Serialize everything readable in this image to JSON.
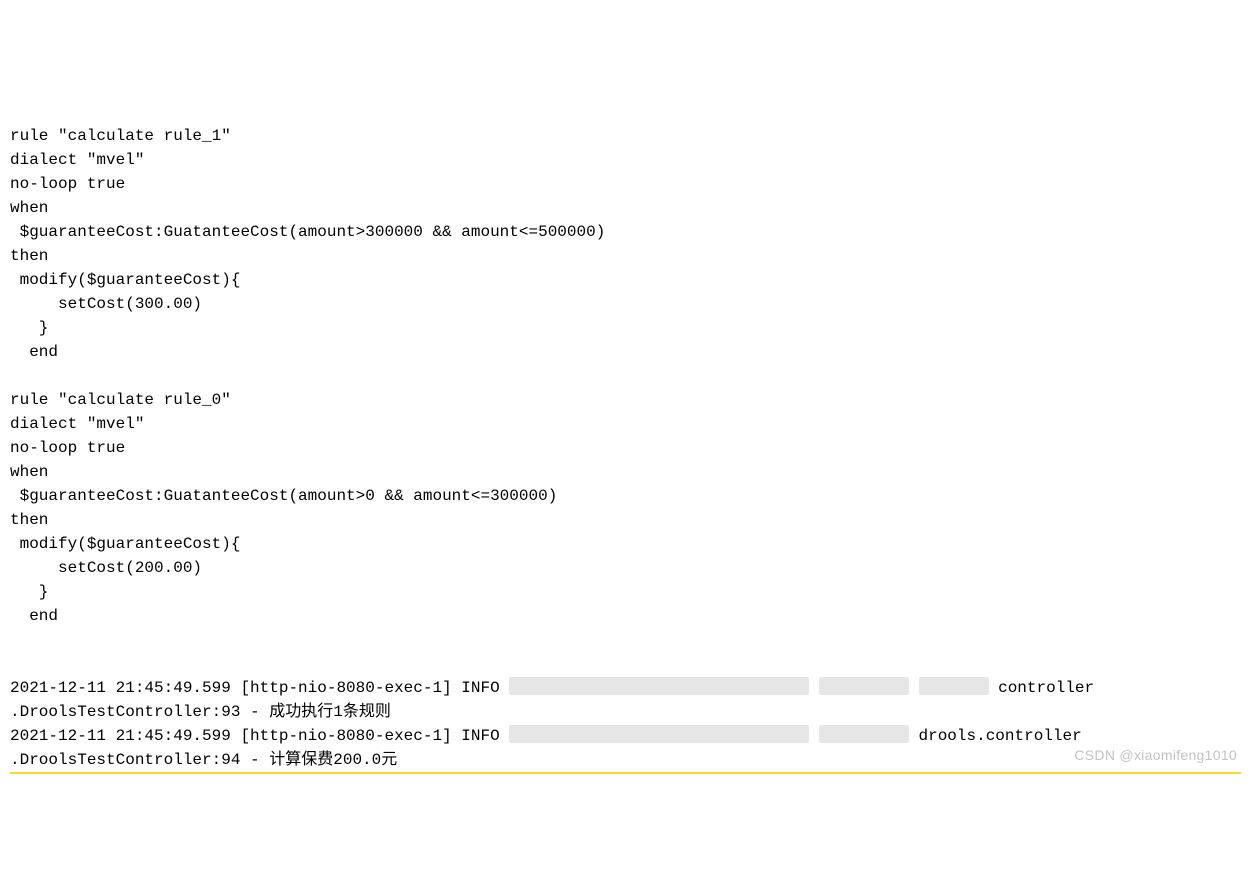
{
  "code": {
    "line1": "rule \"calculate rule_1\"",
    "line2": "dialect \"mvel\"",
    "line3": "no-loop true",
    "line4": "when",
    "line5": " $guaranteeCost:GuatanteeCost(amount>300000 && amount<=500000)",
    "line6": "then",
    "line7": " modify($guaranteeCost){",
    "line8": "     setCost(300.00)",
    "line9": "   }",
    "line10": "  end",
    "blank1": "",
    "line11": "rule \"calculate rule_0\"",
    "line12": "dialect \"mvel\"",
    "line13": "no-loop true",
    "line14": "when",
    "line15": " $guaranteeCost:GuatanteeCost(amount>0 && amount<=300000)",
    "line16": "then",
    "line17": " modify($guaranteeCost){",
    "line18": "     setCost(200.00)",
    "line19": "   }",
    "line20": "  end"
  },
  "log": {
    "l1_prefix": "2021-12-11  21:45:49.599 [http-nio-8080-exec-1] INFO ",
    "l1_suffix": " controller",
    "l2": " .DroolsTestController:93 - 成功执行1条规则",
    "l3_prefix": "2021-12-11  21:45:49.599 [http-nio-8080-exec-1] INFO ",
    "l3_suffix": " drools.controller",
    "l4": " .DroolsTestController:94 - 计算保费200.0元"
  },
  "watermark": "CSDN @xiaomifeng1010"
}
